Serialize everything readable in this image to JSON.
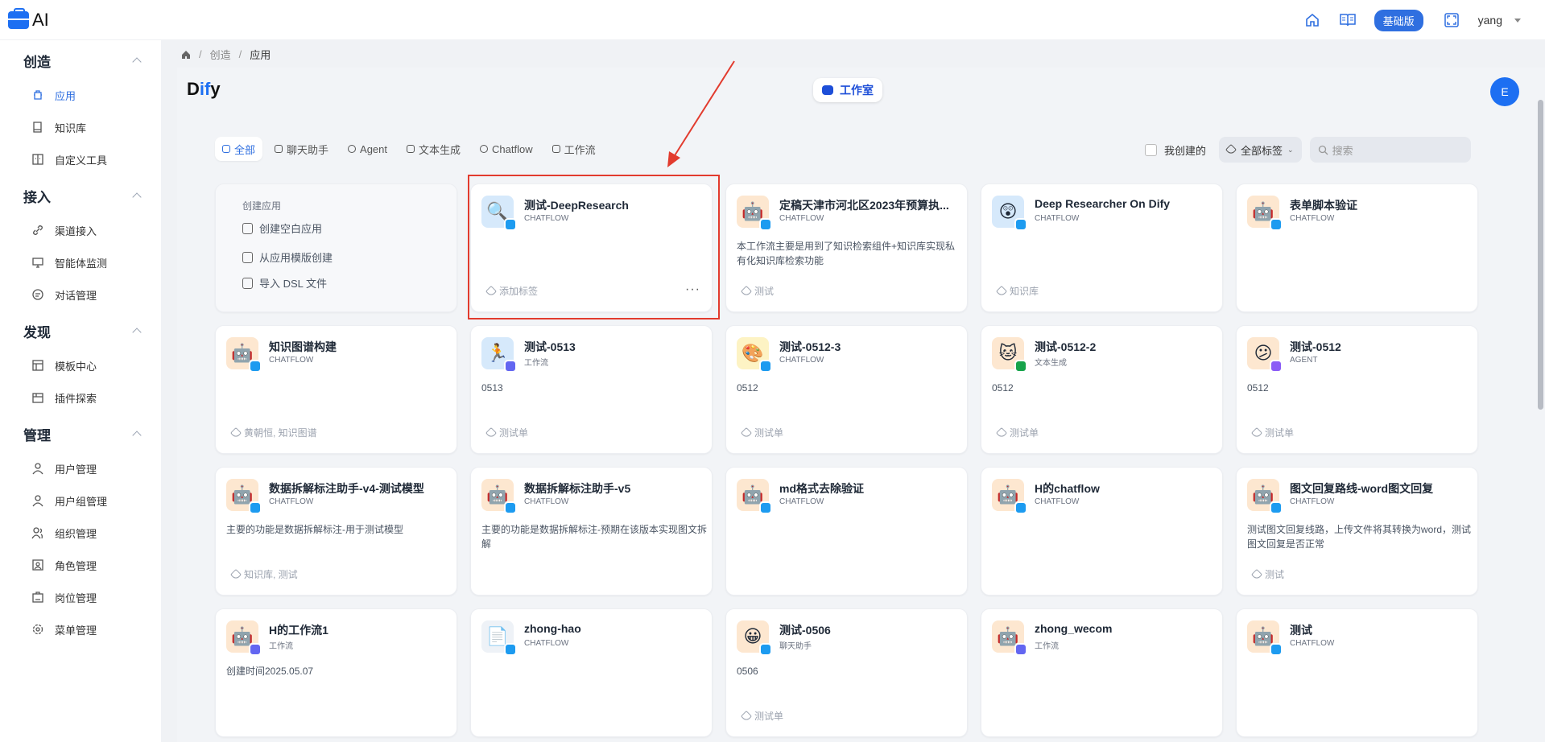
{
  "topbar": {
    "logo_text": "AI",
    "plan_badge": "基础版",
    "user_name": "yang"
  },
  "sidebar": {
    "sections": [
      {
        "title": "创造",
        "items": [
          {
            "label": "应用",
            "active": true,
            "icon": "app-icon"
          },
          {
            "label": "知识库",
            "icon": "book-icon"
          },
          {
            "label": "自定义工具",
            "icon": "tool-icon"
          }
        ]
      },
      {
        "title": "接入",
        "items": [
          {
            "label": "渠道接入",
            "icon": "link-icon"
          },
          {
            "label": "智能体监测",
            "icon": "monitor-icon"
          },
          {
            "label": "对话管理",
            "icon": "chat-icon"
          }
        ]
      },
      {
        "title": "发现",
        "items": [
          {
            "label": "模板中心",
            "icon": "template-icon"
          },
          {
            "label": "插件探索",
            "icon": "plugin-icon"
          }
        ]
      },
      {
        "title": "管理",
        "items": [
          {
            "label": "用户管理",
            "icon": "user-icon"
          },
          {
            "label": "用户组管理",
            "icon": "user-group-icon"
          },
          {
            "label": "组织管理",
            "icon": "org-icon"
          },
          {
            "label": "角色管理",
            "icon": "role-icon"
          },
          {
            "label": "岗位管理",
            "icon": "position-icon"
          },
          {
            "label": "菜单管理",
            "icon": "menu-settings-icon"
          }
        ]
      }
    ]
  },
  "breadcrumb": {
    "items": [
      "创造",
      "应用"
    ]
  },
  "header": {
    "brand_d": "D",
    "brand_if": "if",
    "brand_y": "y",
    "studio_label": "工作室",
    "avatar_letter": "E"
  },
  "filters": {
    "tabs": [
      "全部",
      "聊天助手",
      "Agent",
      "文本生成",
      "Chatflow",
      "工作流"
    ],
    "active_tab": "全部",
    "mine_label": "我创建的",
    "tag_select": "全部标签",
    "search_placeholder": "搜索"
  },
  "create_card": {
    "title": "创建应用",
    "actions": [
      "创建空白应用",
      "从应用模版创建",
      "导入 DSL 文件"
    ]
  },
  "apps": [
    {
      "name": "测试-DeepResearch",
      "type": "CHATFLOW",
      "desc": "",
      "tags": "添加标签",
      "icon": "magnifier-icon",
      "bg": "#d6e9fb",
      "badge": "chat",
      "more": "···"
    },
    {
      "name": "定稿天津市河北区2023年预算执...",
      "type": "CHATFLOW",
      "desc": "本工作流主要是用到了知识检索组件+知识库实现私有化知识库检索功能",
      "tags": "测试",
      "icon": "robot-icon",
      "bg": "#fde7d0",
      "badge": "chat"
    },
    {
      "name": "Deep Researcher On Dify",
      "type": "CHATFLOW",
      "desc": "",
      "tags": "知识库",
      "icon": "astonished-face-icon",
      "bg": "#d6e9fb",
      "badge": "chat"
    },
    {
      "name": "表单脚本验证",
      "type": "CHATFLOW",
      "desc": "",
      "tags": "",
      "icon": "robot-icon",
      "bg": "#fde7d0",
      "badge": "chat"
    },
    {
      "name": "知识图谱构建",
      "type": "CHATFLOW",
      "desc": "",
      "tags": "黄朝恒, 知识图谱",
      "icon": "robot-icon",
      "bg": "#fde7d0",
      "badge": "chat"
    },
    {
      "name": "测试-0513",
      "type": "工作流",
      "desc": "0513",
      "tags": "测试单",
      "icon": "runner-icon",
      "bg": "#d6e9fb",
      "badge": "wf"
    },
    {
      "name": "测试-0512-3",
      "type": "CHATFLOW",
      "desc": "0512",
      "tags": "测试单",
      "icon": "palette-icon",
      "bg": "#fdf3c4",
      "badge": "chat"
    },
    {
      "name": "测试-0512-2",
      "type": "文本生成",
      "desc": "0512",
      "tags": "测试单",
      "icon": "cat-icon",
      "bg": "#fde7d0",
      "badge": "gen"
    },
    {
      "name": "测试-0512",
      "type": "AGENT",
      "desc": "0512",
      "tags": "测试单",
      "icon": "confused-face-icon",
      "bg": "#fde7d0",
      "badge": "agent"
    },
    {
      "name": "数据拆解标注助手-v4-测试模型",
      "type": "CHATFLOW",
      "desc": "主要的功能是数据拆解标注-用于测试模型",
      "tags": "知识库, 测试",
      "icon": "robot-icon",
      "bg": "#fde7d0",
      "badge": "chat"
    },
    {
      "name": "数据拆解标注助手-v5",
      "type": "CHATFLOW",
      "desc": "主要的功能是数据拆解标注-预期在该版本实现图文拆解",
      "tags": "",
      "icon": "robot-icon",
      "bg": "#fde7d0",
      "badge": "chat"
    },
    {
      "name": "md格式去除验证",
      "type": "CHATFLOW",
      "desc": "",
      "tags": "",
      "icon": "robot-icon",
      "bg": "#fde7d0",
      "badge": "chat"
    },
    {
      "name": "H的chatflow",
      "type": "CHATFLOW",
      "desc": "",
      "tags": "",
      "icon": "robot-icon",
      "bg": "#fde7d0",
      "badge": "chat"
    },
    {
      "name": "图文回复路线-word图文回复",
      "type": "CHATFLOW",
      "desc": "测试图文回复线路，上传文件将其转换为word，测试图文回复是否正常",
      "tags": "测试",
      "icon": "robot-icon",
      "bg": "#fde7d0",
      "badge": "chat"
    },
    {
      "name": "H的工作流1",
      "type": "工作流",
      "desc": "创建时间2025.05.07",
      "tags": "",
      "icon": "robot-icon",
      "bg": "#fde7d0",
      "badge": "wf"
    },
    {
      "name": "zhong-hao",
      "type": "CHATFLOW",
      "desc": "",
      "tags": "",
      "icon": "document-icon",
      "bg": "#eef2f7",
      "badge": "chat"
    },
    {
      "name": "测试-0506",
      "type": "聊天助手",
      "desc": "0506",
      "tags": "测试单",
      "icon": "smiley-icon",
      "bg": "#fde7d0",
      "badge": "chat"
    },
    {
      "name": "zhong_wecom",
      "type": "工作流",
      "desc": "",
      "tags": "",
      "icon": "robot-icon",
      "bg": "#fde7d0",
      "badge": "wf"
    },
    {
      "name": "测试",
      "type": "CHATFLOW",
      "desc": "",
      "tags": "",
      "icon": "robot-icon",
      "bg": "#fde7d0",
      "badge": "chat"
    }
  ],
  "colors": {
    "accent": "#2f6fe0",
    "highlight": "#e23b2e"
  }
}
